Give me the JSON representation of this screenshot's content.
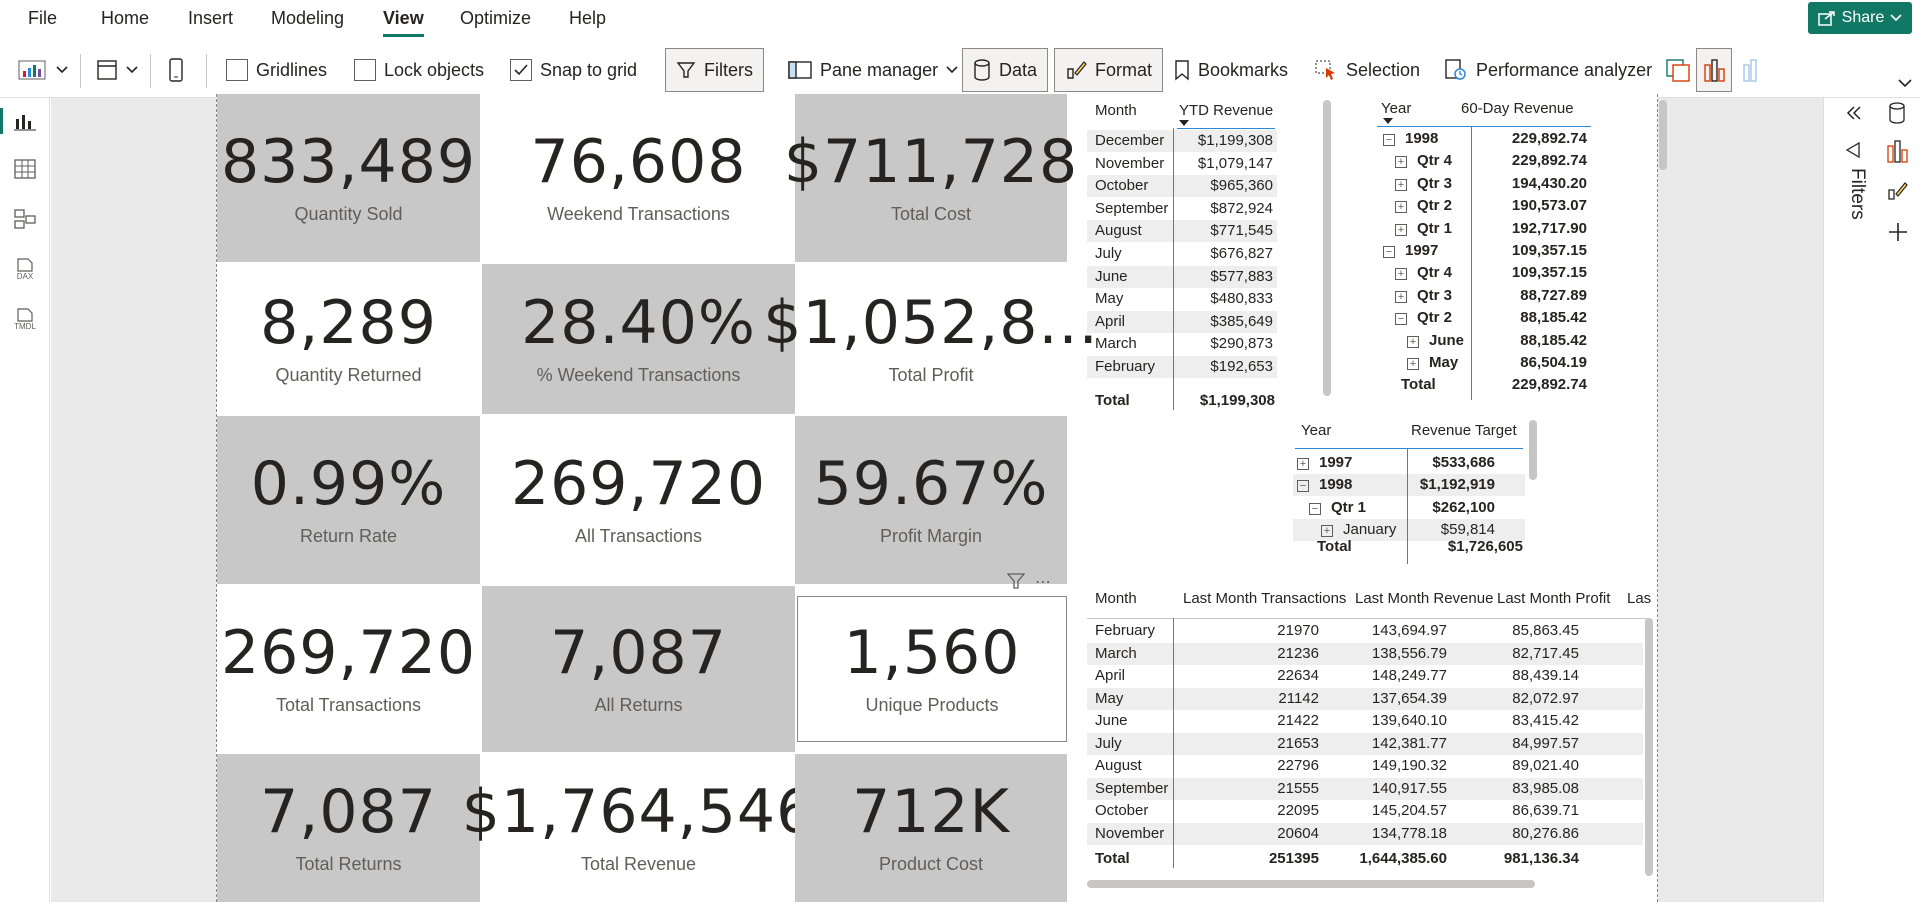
{
  "menu": {
    "items": [
      "File",
      "Home",
      "Insert",
      "Modeling",
      "View",
      "Optimize",
      "Help"
    ],
    "active": "View",
    "share_label": "Share"
  },
  "ribbon": {
    "gridlines": "Gridlines",
    "lock_objects": "Lock objects",
    "snap_to_grid": "Snap to grid",
    "filters": "Filters",
    "pane_manager": "Pane manager",
    "data": "Data",
    "format": "Format",
    "bookmarks": "Bookmarks",
    "selection": "Selection",
    "performance_analyzer": "Performance analyzer",
    "gridlines_checked": false,
    "lock_objects_checked": false,
    "snap_to_grid_checked": true
  },
  "left_rail": {
    "dax_label": "DAX",
    "tmdl_label": "TMDL"
  },
  "right_panel": {
    "filters_label": "Filters"
  },
  "cards": [
    {
      "value": "833,489",
      "label": "Quantity Sold"
    },
    {
      "value": "76,608",
      "label": "Weekend Transactions"
    },
    {
      "value": "$711,728",
      "label": "Total Cost"
    },
    {
      "value": "8,289",
      "label": "Quantity Returned"
    },
    {
      "value": "28.40%",
      "label": "% Weekend Transactions"
    },
    {
      "value": "$1,052,8...",
      "label": "Total Profit"
    },
    {
      "value": "0.99%",
      "label": "Return Rate"
    },
    {
      "value": "269,720",
      "label": "All Transactions"
    },
    {
      "value": "59.67%",
      "label": "Profit Margin"
    },
    {
      "value": "269,720",
      "label": "Total Transactions"
    },
    {
      "value": "7,087",
      "label": "All Returns"
    },
    {
      "value": "1,560",
      "label": "Unique Products"
    },
    {
      "value": "7,087",
      "label": "Total Returns"
    },
    {
      "value": "$1,764,546",
      "label": "Total Revenue"
    },
    {
      "value": "712K",
      "label": "Product Cost"
    }
  ],
  "ytd_table": {
    "headers": [
      "Month",
      "YTD Revenue"
    ],
    "rows": [
      [
        "December",
        "$1,199,308"
      ],
      [
        "November",
        "$1,079,147"
      ],
      [
        "October",
        "$965,360"
      ],
      [
        "September",
        "$872,924"
      ],
      [
        "August",
        "$771,545"
      ],
      [
        "July",
        "$676,827"
      ],
      [
        "June",
        "$577,883"
      ],
      [
        "May",
        "$480,833"
      ],
      [
        "April",
        "$385,649"
      ],
      [
        "March",
        "$290,873"
      ],
      [
        "February",
        "$192,653"
      ]
    ],
    "total_label": "Total",
    "total_value": "$1,199,308"
  },
  "rev60_table": {
    "headers": [
      "Year",
      "60-Day Revenue"
    ],
    "rows": [
      {
        "label": "1998",
        "value": "229,892.74",
        "level": 0,
        "sym": "−"
      },
      {
        "label": "Qtr 4",
        "value": "229,892.74",
        "level": 1,
        "sym": "+"
      },
      {
        "label": "Qtr 3",
        "value": "194,430.20",
        "level": 1,
        "sym": "+"
      },
      {
        "label": "Qtr 2",
        "value": "190,573.07",
        "level": 1,
        "sym": "+"
      },
      {
        "label": "Qtr 1",
        "value": "192,717.90",
        "level": 1,
        "sym": "+"
      },
      {
        "label": "1997",
        "value": "109,357.15",
        "level": 0,
        "sym": "−"
      },
      {
        "label": "Qtr 4",
        "value": "109,357.15",
        "level": 1,
        "sym": "+"
      },
      {
        "label": "Qtr 3",
        "value": "88,727.89",
        "level": 1,
        "sym": "+"
      },
      {
        "label": "Qtr 2",
        "value": "88,185.42",
        "level": 1,
        "sym": "−"
      },
      {
        "label": "June",
        "value": "88,185.42",
        "level": 2,
        "sym": "+"
      },
      {
        "label": "May",
        "value": "86,504.19",
        "level": 2,
        "sym": "+"
      }
    ],
    "total_label": "Total",
    "total_value": "229,892.74"
  },
  "target_table": {
    "headers": [
      "Year",
      "Revenue Target"
    ],
    "rows": [
      {
        "label": "1997",
        "value": "$533,686",
        "level": 0,
        "sym": "+",
        "bold": true
      },
      {
        "label": "1998",
        "value": "$1,192,919",
        "level": 0,
        "sym": "−",
        "bold": true
      },
      {
        "label": "Qtr 1",
        "value": "$262,100",
        "level": 1,
        "sym": "−",
        "bold": true
      },
      {
        "label": "January",
        "value": "$59,814",
        "level": 2,
        "sym": "+",
        "bold": false
      }
    ],
    "total_label": "Total",
    "total_value": "$1,726,605"
  },
  "last_month_table": {
    "headers": [
      "Month",
      "Last Month Transactions",
      "Last Month Revenue",
      "Last Month Profit",
      "Las"
    ],
    "rows": [
      [
        "February",
        "21970",
        "143,694.97",
        "85,863.45"
      ],
      [
        "March",
        "21236",
        "138,556.79",
        "82,717.45"
      ],
      [
        "April",
        "22634",
        "148,249.77",
        "88,439.14"
      ],
      [
        "May",
        "21142",
        "137,654.39",
        "82,072.97"
      ],
      [
        "June",
        "21422",
        "139,640.10",
        "83,415.42"
      ],
      [
        "July",
        "21653",
        "142,381.77",
        "84,997.57"
      ],
      [
        "August",
        "22796",
        "149,190.32",
        "89,021.40"
      ],
      [
        "September",
        "21555",
        "140,917.55",
        "83,985.08"
      ],
      [
        "October",
        "22095",
        "145,204.57",
        "86,639.71"
      ],
      [
        "November",
        "20604",
        "134,778.18",
        "80,276.86"
      ]
    ],
    "total_label": "Total",
    "total_values": [
      "251395",
      "1,644,385.60",
      "981,136.34"
    ]
  }
}
